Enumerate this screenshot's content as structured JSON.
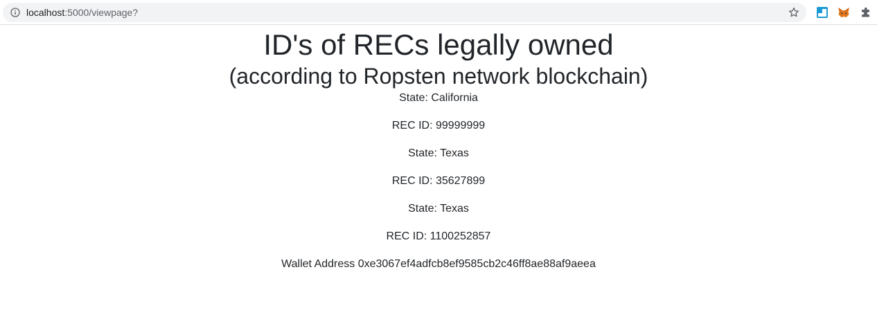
{
  "browser": {
    "url_host": "localhost",
    "url_path": ":5000/viewpage?",
    "icons": {
      "info": "info-icon",
      "bookmark": "star-icon",
      "extensions": [
        "window-extension-icon",
        "metamask-fox-icon",
        "puzzle-extensions-icon"
      ]
    }
  },
  "page": {
    "title": "ID's of RECs legally owned",
    "subtitle": "(according to Ropsten network blockchain)",
    "records": [
      {
        "state": "State: California",
        "rec_id": "REC ID: 99999999"
      },
      {
        "state": "State: Texas",
        "rec_id": "REC ID: 35627899"
      },
      {
        "state": "State: Texas",
        "rec_id": "REC ID: 1100252857"
      }
    ],
    "wallet": "Wallet Address 0xe3067ef4adfcb8ef9585cb2c46ff8ae88af9aeea"
  },
  "colors": {
    "text": "#212529",
    "omnibox_bg": "#f1f3f4",
    "metamask_orange": "#e2761b",
    "extension_blue": "#1a9ad6"
  }
}
